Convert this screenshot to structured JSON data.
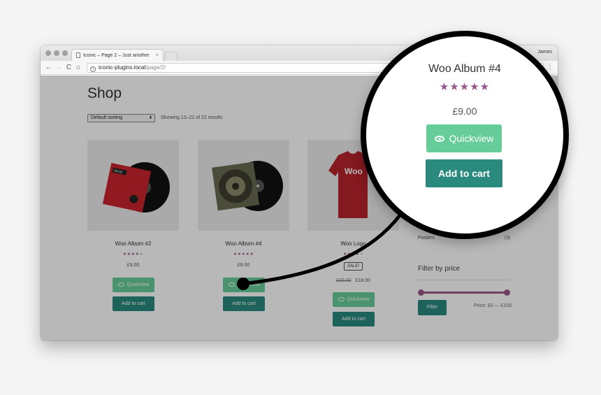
{
  "browser": {
    "tab_title": "Iconic – Page 2 – Just another",
    "tab_close": "×",
    "profile_name": "James",
    "url_host": "iconic-plugins.local",
    "url_path": "/page/2/",
    "back_glyph": "←",
    "forward_glyph": "→",
    "reload_glyph": "C",
    "home_glyph": "⌂",
    "menu_glyph": "⋮"
  },
  "shop": {
    "title": "Shop",
    "sorting": "Default sorting",
    "result_count": "Showing 13–22 of 22 results"
  },
  "products": [
    {
      "name": "Woo Album #2",
      "rating": 4,
      "price": "£9.00",
      "quickview": "Quickview",
      "cart": "Add to cart"
    },
    {
      "name": "Woo Album #4",
      "rating": 5,
      "price": "£9.00",
      "quickview": "Quickview",
      "cart": "Add to cart"
    },
    {
      "name": "Woo Logo",
      "rating": 4,
      "sale": "SALE!",
      "old_price": "£20.00",
      "price": "£18.00",
      "quickview": "Quickview",
      "cart": "Add to cart"
    }
  ],
  "sidebar": {
    "product_link": "Posters",
    "product_count": "(3)",
    "filter_heading": "Filter by price",
    "filter_button": "Filter",
    "price_range": "Price: £0 — £100"
  },
  "magnifier": {
    "title": "Woo Album #4",
    "rating": 5,
    "price": "£9.00",
    "quickview": "Quickview",
    "cart": "Add to cart"
  },
  "icons": {
    "star": "★",
    "quickview_icon": "eye-icon",
    "page_icon": "document-icon",
    "info_icon": "info-icon"
  },
  "colors": {
    "quickview": "#66cc9a",
    "add_to_cart": "#2a8a7e",
    "stars": "#96588a",
    "price_slider": "#96588a"
  }
}
